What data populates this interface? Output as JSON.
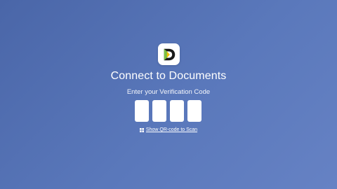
{
  "app": {
    "icon": "documents-app-icon",
    "accent_colors": [
      "#1a1a1a",
      "#7bc043",
      "#f2c200"
    ]
  },
  "header": {
    "title": "Connect to Documents",
    "subtitle": "Enter your Verification Code"
  },
  "verification": {
    "boxes": [
      "",
      "",
      "",
      ""
    ]
  },
  "qr": {
    "icon": "qr-grid-icon",
    "link_label": "Show QR-code to Scan"
  },
  "colors": {
    "background_start": "#4a66a8",
    "background_end": "#6682c4"
  }
}
